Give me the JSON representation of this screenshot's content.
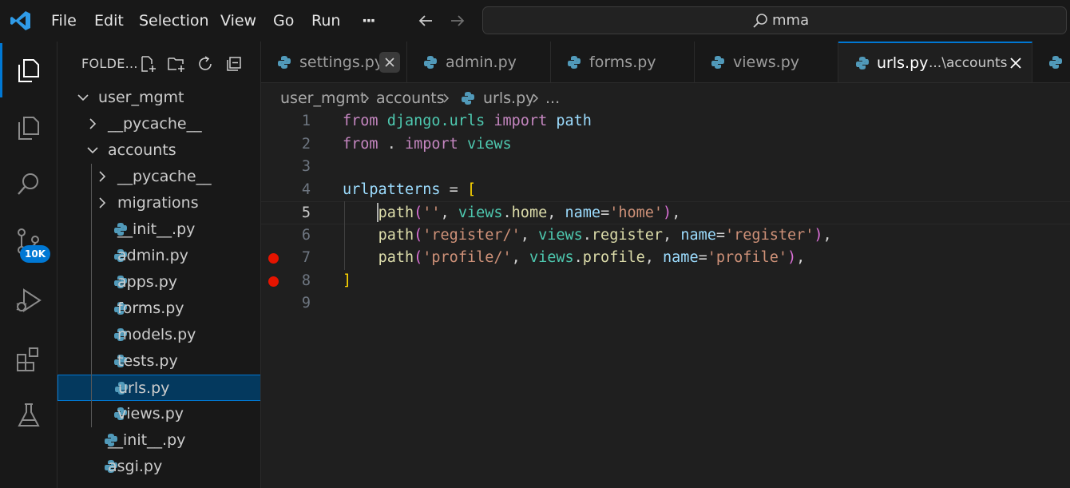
{
  "titlebar": {
    "menu": [
      "File",
      "Edit",
      "Selection",
      "View",
      "Go",
      "Run",
      "···"
    ],
    "search_text": "mma"
  },
  "activitybar": {
    "items": [
      "explorer-icon",
      "copy-icon",
      "search-icon",
      "source-control-icon",
      "run-debug-icon",
      "extensions-icon",
      "testing-icon"
    ],
    "source_control_badge": "10K"
  },
  "sidebar": {
    "title": "FOLDE...",
    "tree": [
      {
        "label": "user_mgmt",
        "type": "folder",
        "expanded": true
      },
      {
        "label": "__pycache__",
        "type": "folder",
        "expanded": false
      },
      {
        "label": "accounts",
        "type": "folder",
        "expanded": true
      },
      {
        "label": "__pycache__",
        "type": "folder",
        "expanded": false
      },
      {
        "label": "migrations",
        "type": "folder",
        "expanded": false
      },
      {
        "label": "__init__.py",
        "type": "python"
      },
      {
        "label": "admin.py",
        "type": "python"
      },
      {
        "label": "apps.py",
        "type": "python"
      },
      {
        "label": "forms.py",
        "type": "python"
      },
      {
        "label": "models.py",
        "type": "python"
      },
      {
        "label": "tests.py",
        "type": "python"
      },
      {
        "label": "urls.py",
        "type": "python",
        "selected": true
      },
      {
        "label": "views.py",
        "type": "python"
      },
      {
        "label": "__init__.py",
        "type": "python"
      },
      {
        "label": "asgi.py",
        "type": "python"
      }
    ]
  },
  "tabs": [
    {
      "label": "settings.py",
      "active": false
    },
    {
      "label": "admin.py",
      "active": false
    },
    {
      "label": "forms.py",
      "active": false
    },
    {
      "label": "views.py",
      "active": false
    },
    {
      "label": "urls.py",
      "description": "...\\accounts",
      "active": true
    }
  ],
  "breadcrumb": [
    "user_mgmt",
    "accounts",
    "urls.py",
    "..."
  ],
  "editor": {
    "current_line": 5,
    "breakpoints": [
      7,
      8
    ],
    "lines": [
      [
        [
          "kw",
          "from"
        ],
        [
          "op",
          " "
        ],
        [
          "mod",
          "django.urls"
        ],
        [
          "op",
          " "
        ],
        [
          "kw",
          "import"
        ],
        [
          "op",
          " "
        ],
        [
          "var",
          "path"
        ]
      ],
      [
        [
          "kw",
          "from"
        ],
        [
          "op",
          " . "
        ],
        [
          "kw",
          "import"
        ],
        [
          "op",
          " "
        ],
        [
          "mod",
          "views"
        ]
      ],
      [],
      [
        [
          "var",
          "urlpatterns"
        ],
        [
          "op",
          " = "
        ],
        [
          "br1",
          "["
        ]
      ],
      [
        [
          "op",
          "    "
        ],
        [
          "fn",
          "path"
        ],
        [
          "br2",
          "("
        ],
        [
          "str",
          "''"
        ],
        [
          "op",
          ", "
        ],
        [
          "mod",
          "views"
        ],
        [
          "op",
          "."
        ],
        [
          "fn",
          "home"
        ],
        [
          "op",
          ", "
        ],
        [
          "var",
          "name"
        ],
        [
          "op",
          "="
        ],
        [
          "str",
          "'home'"
        ],
        [
          "br2",
          ")"
        ],
        [
          "op",
          ","
        ]
      ],
      [
        [
          "op",
          "    "
        ],
        [
          "fn",
          "path"
        ],
        [
          "br2",
          "("
        ],
        [
          "str",
          "'register/'"
        ],
        [
          "op",
          ", "
        ],
        [
          "mod",
          "views"
        ],
        [
          "op",
          "."
        ],
        [
          "fn",
          "register"
        ],
        [
          "op",
          ", "
        ],
        [
          "var",
          "name"
        ],
        [
          "op",
          "="
        ],
        [
          "str",
          "'register'"
        ],
        [
          "br2",
          ")"
        ],
        [
          "op",
          ","
        ]
      ],
      [
        [
          "op",
          "    "
        ],
        [
          "fn",
          "path"
        ],
        [
          "br2",
          "("
        ],
        [
          "str",
          "'profile/'"
        ],
        [
          "op",
          ", "
        ],
        [
          "mod",
          "views"
        ],
        [
          "op",
          "."
        ],
        [
          "fn",
          "profile"
        ],
        [
          "op",
          ", "
        ],
        [
          "var",
          "name"
        ],
        [
          "op",
          "="
        ],
        [
          "str",
          "'profile'"
        ],
        [
          "br2",
          ")"
        ],
        [
          "op",
          ","
        ]
      ],
      [
        [
          "br1",
          "]"
        ]
      ],
      []
    ]
  }
}
